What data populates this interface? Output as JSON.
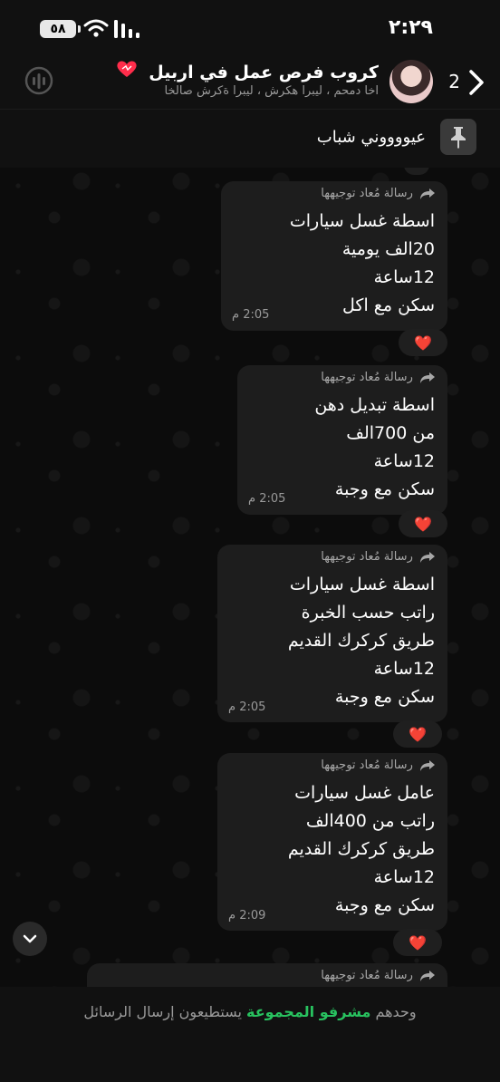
{
  "status_bar": {
    "time": "٢:٢٩",
    "battery": "٥٨"
  },
  "header": {
    "back_count": "2",
    "title": "كروب فرص عمل في اربيل",
    "subtitle": "اخا دمحم ، ليبرا هكرش ، ليبرا ةكرش صالخا"
  },
  "pinned": {
    "text": "عيووووني شباب"
  },
  "messages": [
    {
      "forwarded": "رسالة مُعاد توجيهها",
      "lines": [
        "اسطة غسل سيارات",
        "20الف يومية",
        "12ساعة",
        "سكن مع اكل"
      ],
      "time": "2:05 م",
      "reaction": "❤️"
    },
    {
      "forwarded": "رسالة مُعاد توجيهها",
      "lines": [
        "اسطة تبديل دهن",
        "من 700الف",
        "12ساعة",
        "سكن مع وجبة"
      ],
      "time": "2:05 م",
      "reaction": "❤️"
    },
    {
      "forwarded": "رسالة مُعاد توجيهها",
      "lines": [
        "اسطة غسل سيارات",
        "راتب حسب الخبرة",
        "طريق كركرك القديم",
        "12ساعة",
        "سكن مع وجبة"
      ],
      "time": "2:05 م",
      "reaction": "❤️"
    },
    {
      "forwarded": "رسالة مُعاد توجيهها",
      "lines": [
        "عامل  غسل سيارات",
        "راتب من 400الف",
        "طريق كركرك القديم",
        "12ساعة",
        "سكن مع وجبة"
      ],
      "time": "2:09 م",
      "reaction": "❤️"
    },
    {
      "forwarded": "رسالة مُعاد توجيهها"
    }
  ],
  "footer": {
    "before": "وحدهم",
    "admins": "مشرفو المجموعة",
    "after": "يستطيعون إرسال الرسائل"
  },
  "colors": {
    "accent_green": "#28c25f",
    "bubble": "#1d1d1d",
    "background": "#0c0c0c"
  },
  "icons": [
    "battery-icon",
    "wifi-icon",
    "signal-icon",
    "back-chevron-icon",
    "group-call-icon",
    "pin-icon",
    "forward-icon",
    "heart-reaction-icon",
    "chevron-down-icon"
  ]
}
